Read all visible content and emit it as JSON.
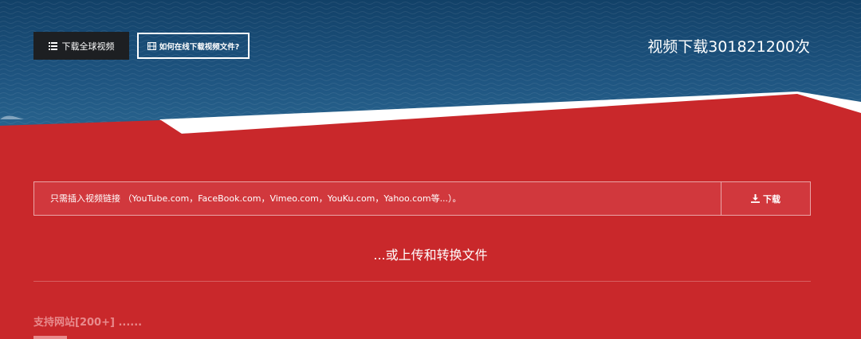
{
  "header": {
    "download_global_label": "下载全球视频",
    "howto_label": "如何在线下载视频文件?",
    "counter_text": "视频下载301821200次"
  },
  "search": {
    "placeholder": "只需插入视频链接 （YouTube.com，FaceBook.com，Vimeo.com，YouKu.com，Yahoo.com等...）。",
    "value": "",
    "download_label": "下载"
  },
  "upload": {
    "label": "...或上传和转换文件"
  },
  "supported": {
    "label": "支持网站[200+] ......"
  },
  "icons": {
    "list": "list-icon",
    "film": "film-icon",
    "download": "download-icon"
  },
  "colors": {
    "background_red": "#c9282b",
    "input_red": "#d1383d",
    "dark_button": "#1d1f22",
    "sea_blue": "#1d4f78",
    "supported_text": "#e88a8c"
  }
}
